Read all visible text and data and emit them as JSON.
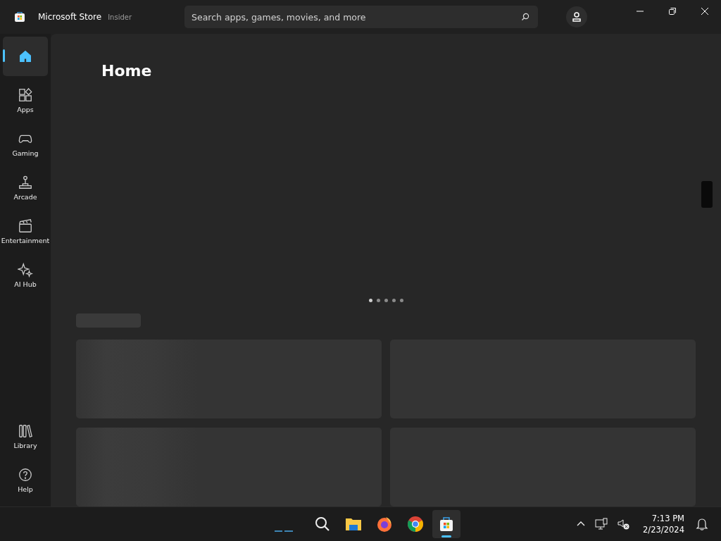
{
  "app": {
    "title": "Microsoft Store",
    "channel": "Insider"
  },
  "search": {
    "placeholder": "Search apps, games, movies, and more"
  },
  "nav": {
    "items": [
      {
        "kind": "home",
        "selected": true
      },
      {
        "kind": "apps",
        "label": "Apps",
        "selected": false
      },
      {
        "kind": "gaming",
        "label": "Gaming",
        "selected": false
      },
      {
        "kind": "arcade",
        "label": "Arcade",
        "selected": false
      },
      {
        "kind": "entertainment",
        "label": "Entertainment",
        "selected": false
      },
      {
        "kind": "ai",
        "label": "AI Hub",
        "selected": false
      }
    ],
    "bottom": [
      {
        "kind": "library",
        "label": "Library",
        "selected": false
      },
      {
        "kind": "help",
        "label": "Help",
        "selected": false
      }
    ]
  },
  "page": {
    "heading": "Home",
    "carousel_dots": [
      {
        "selected": true
      },
      {
        "selected": false
      },
      {
        "selected": false
      },
      {
        "selected": false
      },
      {
        "selected": false
      }
    ]
  },
  "taskbar": {
    "apps": [
      {
        "kind": "search",
        "selected": false
      },
      {
        "kind": "files",
        "selected": false
      },
      {
        "kind": "firefox",
        "selected": false
      },
      {
        "kind": "chrome",
        "selected": false
      },
      {
        "kind": "store",
        "selected": true
      }
    ],
    "time": "7:13 PM",
    "date": "2/23/2024"
  }
}
